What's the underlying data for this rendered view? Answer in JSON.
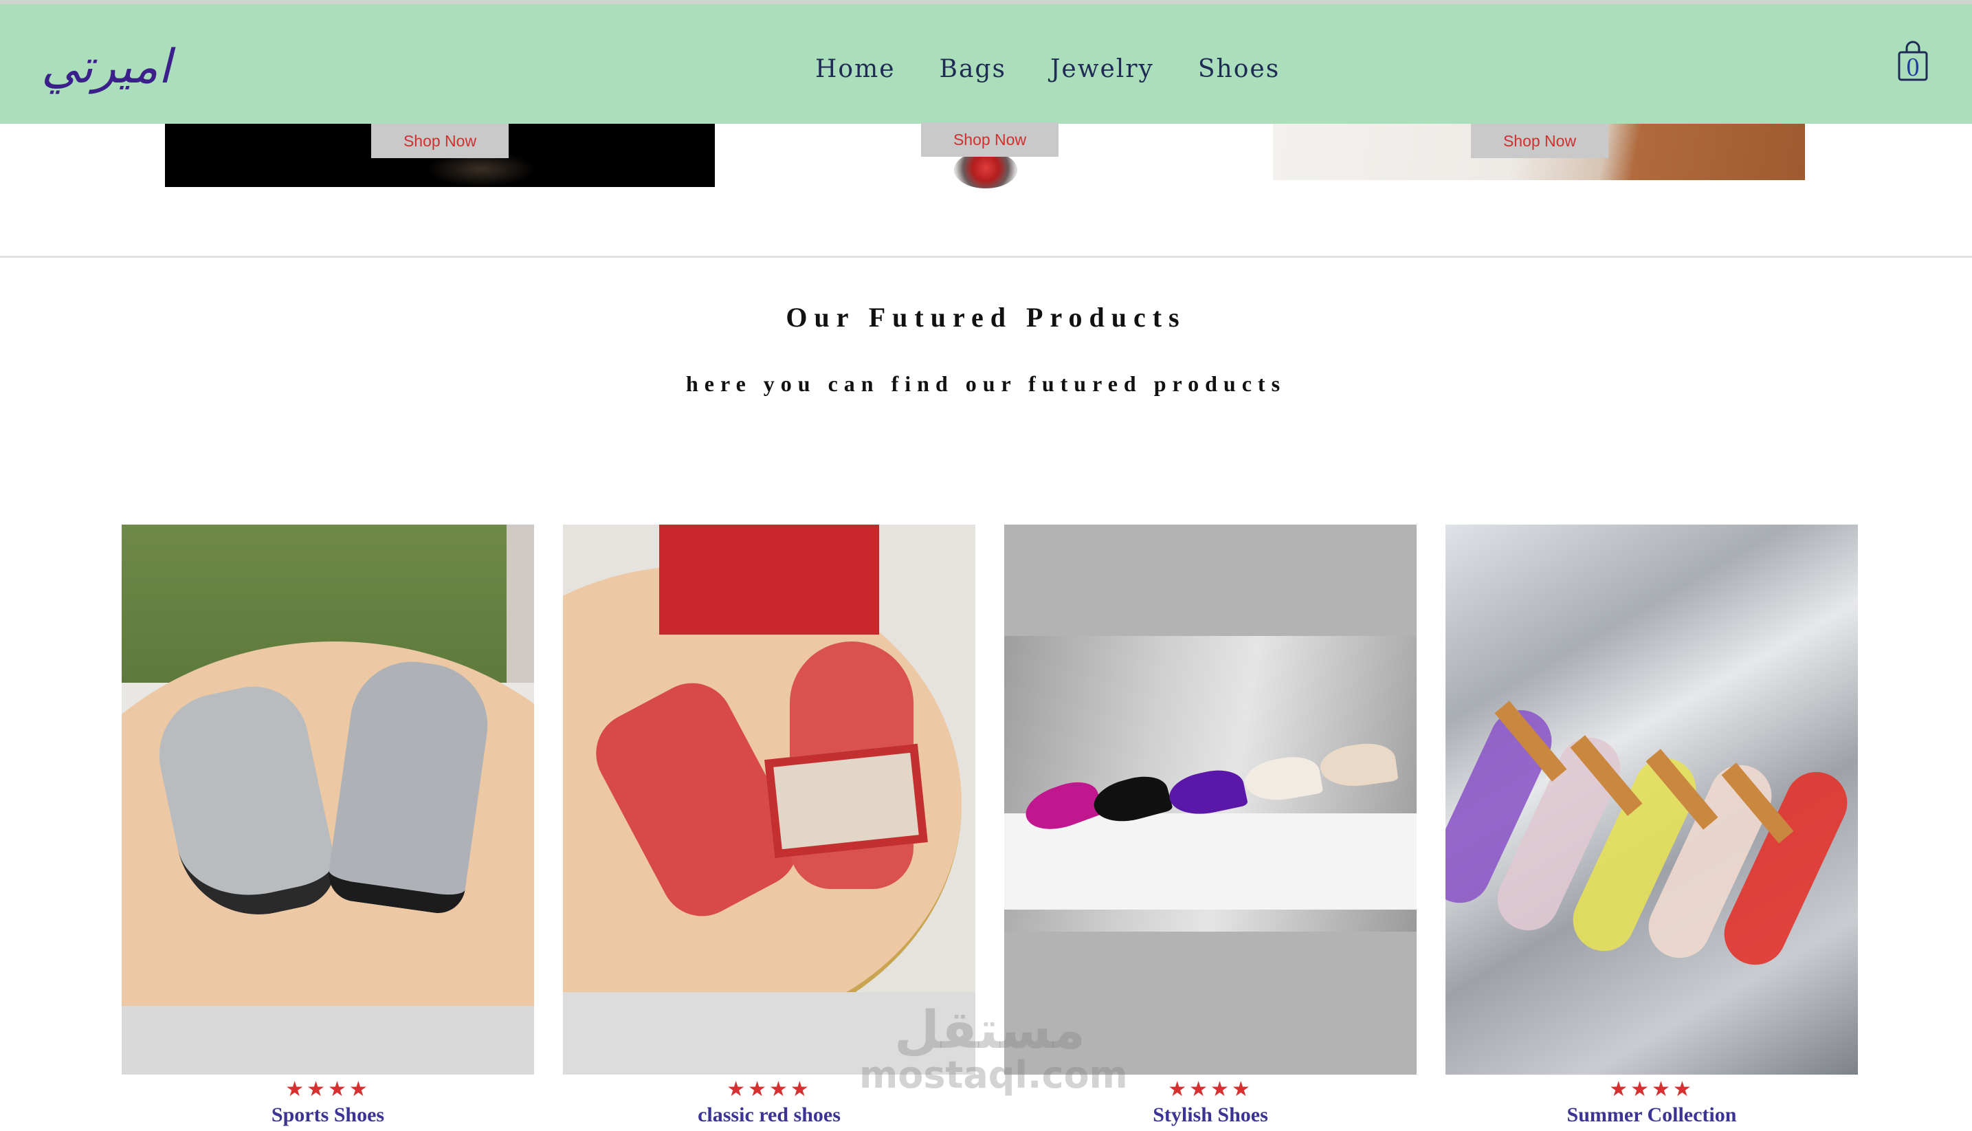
{
  "header": {
    "logo_text": "اميرتي",
    "nav": [
      {
        "label": "Home"
      },
      {
        "label": "Bags"
      },
      {
        "label": "Jewelry"
      },
      {
        "label": "Shoes"
      }
    ],
    "cart_count": "0",
    "background_color": "#abdfbb"
  },
  "banners": [
    {
      "button_label": "Shop Now"
    },
    {
      "button_label": "Shop Now"
    },
    {
      "button_label": "Shop Now"
    }
  ],
  "featured": {
    "title": "Our Futured Products",
    "subtitle": "here you can find our futured products"
  },
  "products": [
    {
      "name": "Sports Shoes",
      "rating": "★★★★"
    },
    {
      "name": "classic red shoes",
      "rating": "★★★★"
    },
    {
      "name": "Stylish Shoes",
      "rating": "★★★★"
    },
    {
      "name": "Summer Collection",
      "rating": "★★★★"
    }
  ],
  "watermark": {
    "arabic": "مستقل",
    "latin": "mostaql.com"
  }
}
